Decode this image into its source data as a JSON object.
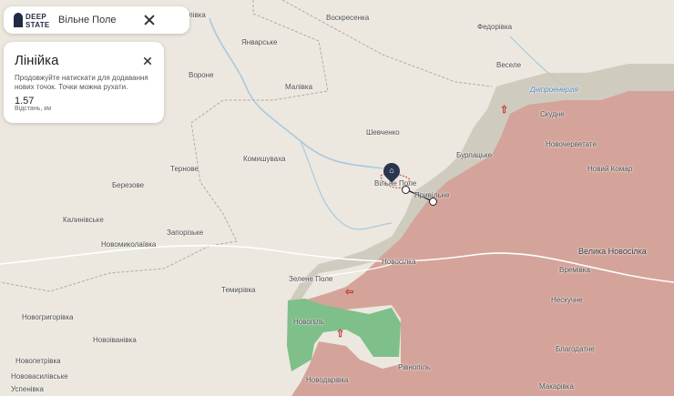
{
  "topbar": {
    "logo_line1": "DEEP",
    "logo_line2": "STATE",
    "place": "Вільне Поле"
  },
  "ruler": {
    "title": "Лінійка",
    "hint": "Продовжуйте натискати для додавання нових точок. Точки можна рухати.",
    "value": "1.57",
    "unit": "Відстань, км"
  },
  "map": {
    "colors": {
      "background": "#ece8df",
      "occupied": "#d4a49a",
      "contested": "#c9c4b8",
      "liberated": "#7fbf8a",
      "roads": "#ffffff",
      "water": "#a9c9dd",
      "admin_border": "#b7a6a6",
      "arrow": "#c2353a"
    },
    "labels": {
      "novoselivka": "Новоселівка",
      "voskresenka": "Воскресенка",
      "fedorivka": "Федорівка",
      "yanvarske": "Январське",
      "vorone": "Вороне",
      "malivka": "Малівка",
      "vesele": "Веселе",
      "dniproenerhiia": "Дніпроенергія",
      "skudne": "Скудне",
      "shevchenko": "Шевченко",
      "novochervone": "Новочерветате",
      "burlatske": "Бурлацьке",
      "ternove": "Тернове",
      "komyshuvakha": "Комишуваха",
      "novyi_komar": "Новий Комар",
      "berezove": "Березове",
      "vilne_pole": "Вільне Поле",
      "pryvilne": "Привільне",
      "kalynivske": "Калинівське",
      "zaporizke": "Запорізьке",
      "novomykolaivka": "Новомиколаївка",
      "velyka_novosilka": "Велика Новосілка",
      "novosilka": "Новосілка",
      "vremivka": "Времівка",
      "zelene_pole": "Зелене Поле",
      "temyrivka": "Темирівка",
      "neskuchne": "Нескучне",
      "novohryhorivka": "Новогригорівка",
      "novopil": "Новопіль",
      "novoivanivka": "Новоіванівка",
      "blahodatne": "Благодатне",
      "novopetrivka": "Новопетрівка",
      "rivnopil": "Рівнопіль",
      "novovasylivske": "Нововасилівське",
      "novodarivka": "Новодарівка",
      "makarivka": "Макарівка",
      "uspenivka": "Успенівка"
    },
    "pin_icon": "home-icon",
    "arrow_icon": "attack-arrow-icon"
  }
}
